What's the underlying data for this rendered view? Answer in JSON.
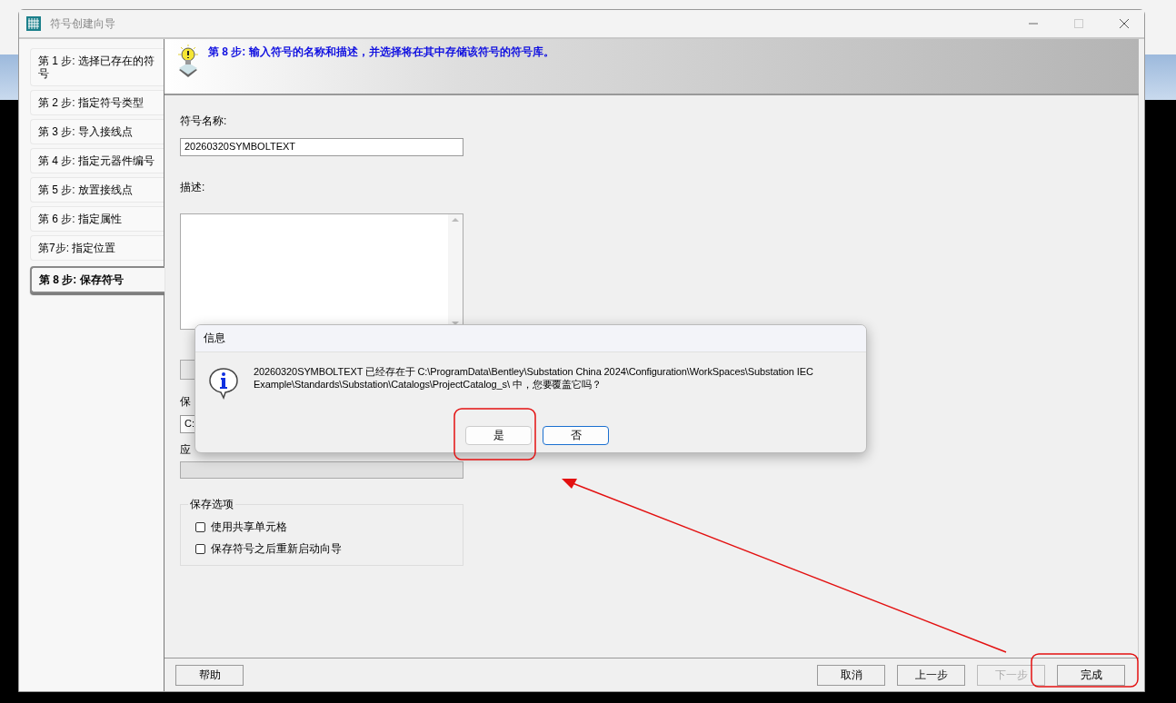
{
  "window": {
    "title": "符号创建向导"
  },
  "steps": [
    {
      "label": "第 1 步: 选择已存在的符号",
      "selected": false
    },
    {
      "label": "第 2 步: 指定符号类型",
      "selected": false
    },
    {
      "label": "第 3 步: 导入接线点",
      "selected": false
    },
    {
      "label": "第 4 步: 指定元器件编号",
      "selected": false
    },
    {
      "label": "第 5 步: 放置接线点",
      "selected": false
    },
    {
      "label": "第 6 步: 指定属性",
      "selected": false
    },
    {
      "label": "第7步: 指定位置",
      "selected": false
    },
    {
      "label": "第 8 步: 保存符号",
      "selected": true
    }
  ],
  "header": {
    "title": "第 8 步: 输入符号的名称和描述，并选择将在其中存储该符号的符号库。"
  },
  "form": {
    "name_label": "符号名称:",
    "name_value": "20260320SYMBOLTEXT",
    "description_label": "描述:",
    "library_label": "保",
    "library_value": "C:",
    "application_label": "应",
    "options": {
      "title": "保存选项",
      "items": [
        {
          "label": "使用共享单元格",
          "checked": false
        },
        {
          "label": "保存符号之后重新启动向导",
          "checked": false
        }
      ]
    }
  },
  "buttons": [
    {
      "label": "帮助",
      "disabled": false
    },
    {
      "label": "取消",
      "disabled": false
    },
    {
      "label": "上一步",
      "disabled": false
    },
    {
      "label": "下一步",
      "disabled": true
    },
    {
      "label": "完成",
      "disabled": false
    }
  ],
  "message": {
    "title": "信息",
    "text": "20260320SYMBOLTEXT 已经存在于 C:\\ProgramData\\Bentley\\Substation China 2024\\Configuration\\WorkSpaces\\Substation IEC Example\\Standards\\Substation\\Catalogs\\ProjectCatalog_s\\ 中，您要覆盖它吗？",
    "buttons": [
      {
        "label": "是",
        "default": false
      },
      {
        "label": "否",
        "default": true
      }
    ]
  }
}
